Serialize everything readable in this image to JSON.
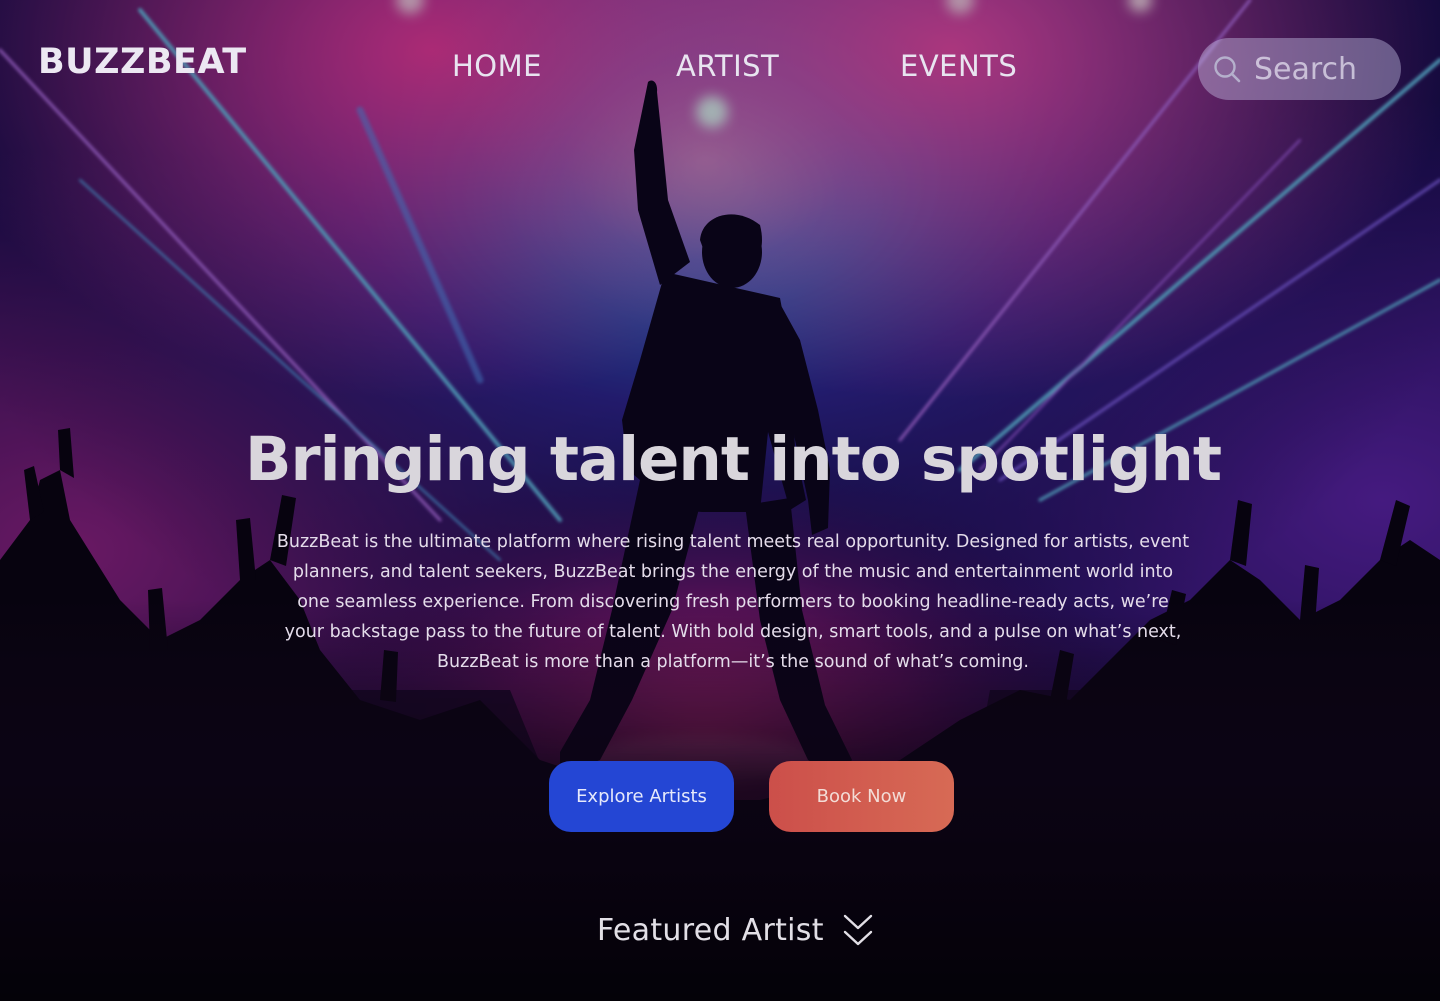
{
  "brand": {
    "logo": "BUZZBEAT"
  },
  "nav": {
    "items": [
      {
        "label": "HOME"
      },
      {
        "label": "ARTIST"
      },
      {
        "label": "EVENTS"
      }
    ],
    "search_placeholder": "Search",
    "search_icon": "search-icon"
  },
  "hero": {
    "title": "Bringing talent into spotlight",
    "description": "BuzzBeat is the ultimate platform where rising talent meets real opportunity. Designed for artists, event planners, and talent seekers, BuzzBeat brings the energy of the music and entertainment world into one seamless experience. From discovering fresh performers to booking headline-ready acts, we’re your backstage pass to the future of talent. With bold design, smart tools, and a pulse on what’s next, BuzzBeat is more than a platform—it’s the sound of what’s coming.",
    "primary_button": "Explore Artists",
    "secondary_button": "Book Now"
  },
  "featured": {
    "label": "Featured Artist",
    "icon": "chevron-down-icon"
  },
  "colors": {
    "primary_button": "#2446d4",
    "secondary_button": "#d0584d",
    "background": "#0a0620"
  }
}
